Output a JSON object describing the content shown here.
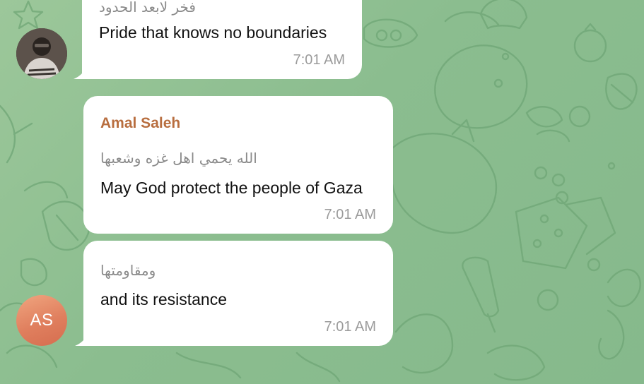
{
  "chat": {
    "background_color": "#8fbf91",
    "bubble_color": "#ffffff",
    "messages": [
      {
        "sender": "",
        "arabic": "فخر لابعد الحدود",
        "english": "Pride that knows no boundaries",
        "time": "7:01 AM",
        "avatar": "user-photo"
      },
      {
        "sender": "Amal Saleh",
        "sender_color": "#b86e3f",
        "arabic": "الله يحمي اهل غزه وشعبها",
        "english": "May God protect the people of Gaza",
        "time": "7:01 AM"
      },
      {
        "sender": "",
        "arabic": "ومقاومتها",
        "english": "and its resistance",
        "time": "7:01 AM",
        "avatar_initials": "AS",
        "avatar_color": "#e07f5e"
      }
    ]
  }
}
